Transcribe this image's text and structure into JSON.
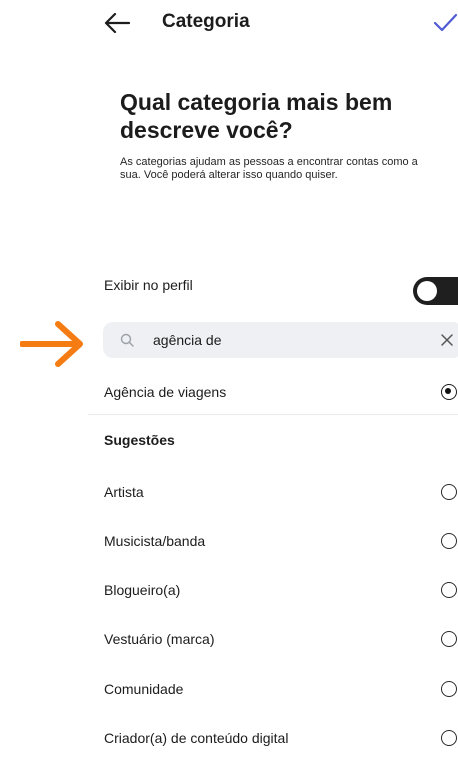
{
  "header": {
    "title": "Categoria"
  },
  "page": {
    "title": "Qual categoria mais bem descreve você?",
    "description": "As categorias ajudam as pessoas a encontrar contas como a sua. Você poderá alterar isso quando quiser."
  },
  "show_on_profile": {
    "label": "Exibir no perfil",
    "enabled": true
  },
  "search": {
    "value": "agência de"
  },
  "selected_result": {
    "label": "Agência de viagens",
    "selected": true
  },
  "suggestions": {
    "title": "Sugestões",
    "items": [
      {
        "label": "Artista"
      },
      {
        "label": "Musicista/banda"
      },
      {
        "label": "Blogueiro(a)"
      },
      {
        "label": "Vestuário (marca)"
      },
      {
        "label": "Comunidade"
      },
      {
        "label": "Criador(a) de conteúdo digital"
      }
    ]
  },
  "colors": {
    "accent": "#4f5bd5",
    "annotation_arrow": "#f57c12",
    "toggle_on": "#1f1f1f"
  },
  "icons": [
    "back-arrow-icon",
    "checkmark-icon",
    "search-icon",
    "clear-icon",
    "annotation-arrow-icon"
  ]
}
